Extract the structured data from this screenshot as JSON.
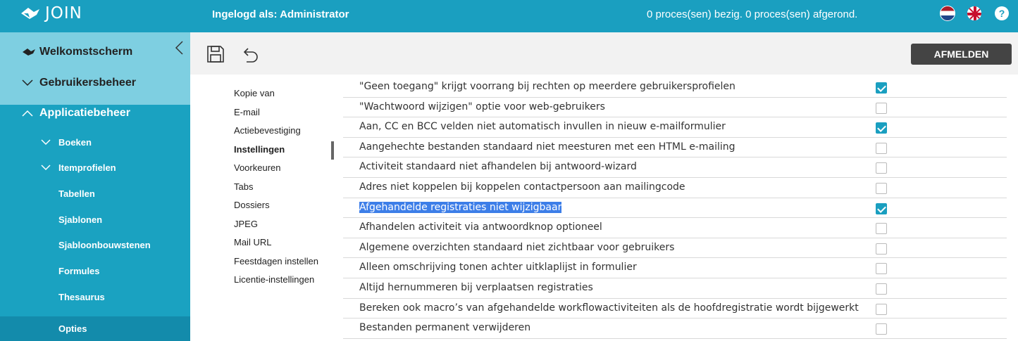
{
  "header": {
    "app_name": "JOIN",
    "login_label": "Ingelogd als: Administrator",
    "process_status": "0 proces(sen) bezig. 0 proces(sen) afgerond.",
    "help_symbol": "?",
    "icons": [
      "logo-icon",
      "flag-nl-icon",
      "flag-uk-icon",
      "help-icon"
    ]
  },
  "sidebar": {
    "items": [
      {
        "label": "Welkomstscherm",
        "icon": "home-icon"
      },
      {
        "label": "Gebruikersbeheer",
        "icon": "chevron-down-icon"
      },
      {
        "label": "Applicatiebeheer",
        "icon": "chevron-up-icon"
      },
      {
        "label": "Boeken",
        "icon": "chevron-down-icon"
      },
      {
        "label": "Itemprofielen",
        "icon": "chevron-down-icon"
      },
      {
        "label": "Tabellen"
      },
      {
        "label": "Sjablonen"
      },
      {
        "label": "Sjabloonbouwstenen"
      },
      {
        "label": "Formules"
      },
      {
        "label": "Thesaurus"
      },
      {
        "label": "Opties"
      }
    ]
  },
  "toolbar": {
    "logout_label": "AFMELDEN"
  },
  "subnav": {
    "items": [
      "Kopie van",
      "E-mail",
      "Actiebevestiging",
      "Instellingen",
      "Voorkeuren",
      "Tabs",
      "Dossiers",
      "JPEG",
      "Mail URL",
      "Feestdagen instellen",
      "Licentie-instellingen"
    ],
    "active": "Instellingen"
  },
  "settings": {
    "rows": [
      {
        "label": "\"Geen toegang\" krijgt voorrang bij rechten op meerdere gebruikersprofielen",
        "checked": true
      },
      {
        "label": "\"Wachtwoord wijzigen\" optie voor web-gebruikers",
        "checked": false
      },
      {
        "label": "Aan, CC en BCC velden niet automatisch invullen in nieuw e-mailformulier",
        "checked": true
      },
      {
        "label": "Aangehechte bestanden standaard niet meesturen met een HTML e-mailing",
        "checked": false
      },
      {
        "label": "Activiteit standaard niet afhandelen bij antwoord-wizard",
        "checked": false
      },
      {
        "label": "Adres niet koppelen bij koppelen contactpersoon aan mailingcode",
        "checked": false
      },
      {
        "label": "Afgehandelde registraties niet wijzigbaar",
        "checked": true,
        "selected": true
      },
      {
        "label": "Afhandelen activiteit via antwoordknop optioneel",
        "checked": false
      },
      {
        "label": "Algemene overzichten standaard niet zichtbaar voor gebruikers",
        "checked": false
      },
      {
        "label": "Alleen omschrijving tonen achter uitklaplijst in formulier",
        "checked": false
      },
      {
        "label": "Altijd hernummeren bij verplaatsen registraties",
        "checked": false
      },
      {
        "label": "Bereken ook macro’s van afgehandelde workflowactiviteiten als de hoofdregistratie wordt bijgewerkt",
        "checked": false
      },
      {
        "label": "Bestanden permanent verwijderen",
        "checked": false
      }
    ]
  },
  "colors": {
    "primary": "#1a9fc0",
    "sidebar_light": "#7ecfe1",
    "sidebar_active": "#138bab",
    "selection": "#3d7ee8",
    "button_dark": "#444444"
  }
}
